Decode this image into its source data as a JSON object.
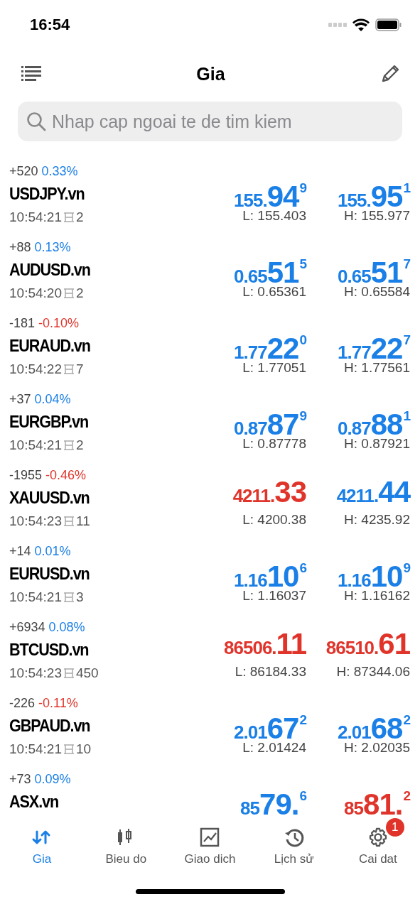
{
  "status_bar": {
    "time": "16:54"
  },
  "header": {
    "title": "Gia"
  },
  "search": {
    "placeholder": "Nhap cap ngoai te de tim kiem"
  },
  "quotes": [
    {
      "change": "+520",
      "percent": "0.33%",
      "color": "#1a7fe6",
      "symbol": "USDJPY.vn",
      "time": "10:54:21",
      "spread": "2",
      "bid": {
        "head": "155.",
        "big": "94",
        "tail": "9",
        "color": "#1a7fe6"
      },
      "ask": {
        "head": "155.",
        "big": "95",
        "tail": "1",
        "color": "#1a7fe6"
      },
      "low": "L: 155.403",
      "high": "H: 155.977"
    },
    {
      "change": "+88",
      "percent": "0.13%",
      "color": "#1a7fe6",
      "symbol": "AUDUSD.vn",
      "time": "10:54:20",
      "spread": "2",
      "bid": {
        "head": "0.65",
        "big": "51",
        "tail": "5",
        "color": "#1a7fe6"
      },
      "ask": {
        "head": "0.65",
        "big": "51",
        "tail": "7",
        "color": "#1a7fe6"
      },
      "low": "L: 0.65361",
      "high": "H: 0.65584"
    },
    {
      "change": "-181",
      "percent": "-0.10%",
      "color": "#e0342b",
      "symbol": "EURAUD.vn",
      "time": "10:54:22",
      "spread": "7",
      "bid": {
        "head": "1.77",
        "big": "22",
        "tail": "0",
        "color": "#1a7fe6"
      },
      "ask": {
        "head": "1.77",
        "big": "22",
        "tail": "7",
        "color": "#1a7fe6"
      },
      "low": "L: 1.77051",
      "high": "H: 1.77561"
    },
    {
      "change": "+37",
      "percent": "0.04%",
      "color": "#1a7fe6",
      "symbol": "EURGBP.vn",
      "time": "10:54:21",
      "spread": "2",
      "bid": {
        "head": "0.87",
        "big": "87",
        "tail": "9",
        "color": "#1a7fe6"
      },
      "ask": {
        "head": "0.87",
        "big": "88",
        "tail": "1",
        "color": "#1a7fe6"
      },
      "low": "L: 0.87778",
      "high": "H: 0.87921"
    },
    {
      "change": "-1955",
      "percent": "-0.46%",
      "color": "#e0342b",
      "symbol": "XAUUSD.vn",
      "time": "10:54:23",
      "spread": "11",
      "bid": {
        "head": "4211.",
        "big": "33",
        "color": "#e0342b"
      },
      "ask": {
        "head": "4211.",
        "big": "44",
        "color": "#1a7fe6"
      },
      "low": "L: 4200.38",
      "high": "H: 4235.92"
    },
    {
      "change": "+14",
      "percent": "0.01%",
      "color": "#1a7fe6",
      "symbol": "EURUSD.vn",
      "time": "10:54:21",
      "spread": "3",
      "bid": {
        "head": "1.16",
        "big": "10",
        "tail": "6",
        "color": "#1a7fe6"
      },
      "ask": {
        "head": "1.16",
        "big": "10",
        "tail": "9",
        "color": "#1a7fe6"
      },
      "low": "L: 1.16037",
      "high": "H: 1.16162"
    },
    {
      "change": "+6934",
      "percent": "0.08%",
      "color": "#1a7fe6",
      "symbol": "BTCUSD.vn",
      "time": "10:54:23",
      "spread": "450",
      "bid": {
        "head": "86506.",
        "big": "11",
        "color": "#e0342b"
      },
      "ask": {
        "head": "86510.",
        "big": "61",
        "color": "#e0342b"
      },
      "low": "L: 86184.33",
      "high": "H: 87344.06"
    },
    {
      "change": "-226",
      "percent": "-0.11%",
      "color": "#e0342b",
      "symbol": "GBPAUD.vn",
      "time": "10:54:21",
      "spread": "10",
      "bid": {
        "head": "2.01",
        "big": "67",
        "tail": "2",
        "color": "#1a7fe6"
      },
      "ask": {
        "head": "2.01",
        "big": "68",
        "tail": "2",
        "color": "#1a7fe6"
      },
      "low": "L: 2.01424",
      "high": "H: 2.02035"
    },
    {
      "change": "+73",
      "percent": "0.09%",
      "color": "#1a7fe6",
      "symbol": "ASX.vn",
      "bid": {
        "head": "85",
        "big": "79.",
        "tail": "6",
        "color": "#1a7fe6"
      },
      "ask": {
        "head": "85",
        "big": "81.",
        "tail": "2",
        "color": "#e0342b"
      }
    }
  ],
  "tabs": [
    {
      "label": "Gia",
      "kind": "quotes",
      "selected": true
    },
    {
      "label": "Bieu do",
      "kind": "chart",
      "selected": false
    },
    {
      "label": "Giao dich",
      "kind": "trade",
      "selected": false
    },
    {
      "label": "Lịch sử",
      "kind": "history",
      "selected": false
    },
    {
      "label": "Cai dat",
      "kind": "settings",
      "selected": false,
      "badge": "1"
    }
  ]
}
